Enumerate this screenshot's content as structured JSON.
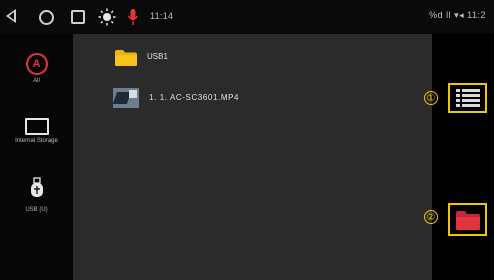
{
  "statusbar": {
    "time": "11:14",
    "right_status": "%d ll ▾◂ 11:2"
  },
  "sidebar": {
    "items": [
      {
        "label": "All",
        "icon": "all-icon"
      },
      {
        "label": "Internal Storage",
        "icon": "storage-icon"
      },
      {
        "label": "USB (U)",
        "icon": "usb-icon"
      }
    ]
  },
  "main": {
    "rows": [
      {
        "label": "USB1",
        "icon": "folder-icon"
      },
      {
        "label": "1.  1. AC-SC3601.MP4",
        "icon": "video-thumbnail-icon"
      }
    ]
  },
  "annotations": {
    "callout_1": "①",
    "callout_2": "②",
    "highlight_color": "#f0c800"
  },
  "colors": {
    "accent_red": "#e2343d",
    "folder_yellow": "#f0b400",
    "panel_bg": "#2b2b2b"
  }
}
